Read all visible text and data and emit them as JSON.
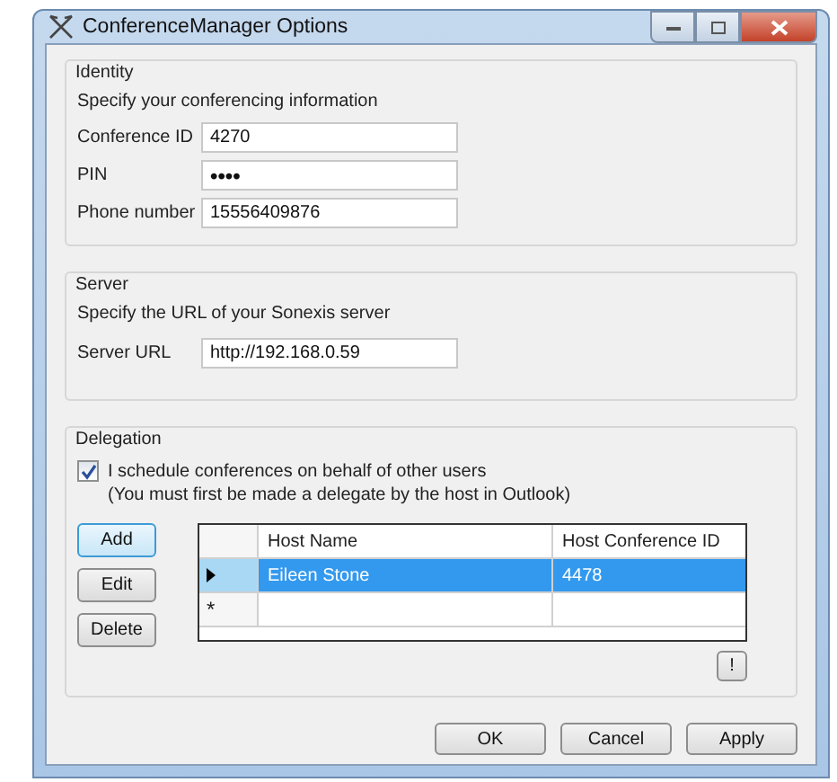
{
  "window": {
    "title": "ConferenceManager Options"
  },
  "identity": {
    "title": "Identity",
    "description": "Specify your conferencing information",
    "fields": [
      {
        "label": "Conference ID",
        "value": "4270"
      },
      {
        "label": "PIN",
        "value": "••••"
      },
      {
        "label": "Phone number",
        "value": "15556409876"
      }
    ]
  },
  "server": {
    "title": "Server",
    "description": "Specify the URL of your Sonexis server",
    "fields": [
      {
        "label": "Server URL",
        "value": "http://192.168.0.59"
      }
    ]
  },
  "delegation": {
    "title": "Delegation",
    "checkbox": {
      "label": "I schedule conferences on behalf of other users",
      "checked": true
    },
    "note": "(You must first be made a delegate by the host in Outlook)",
    "buttons": [
      "Add",
      "Edit",
      "Delete"
    ],
    "table": {
      "columns": [
        "Host Name",
        "Host Conference ID"
      ],
      "rows": [
        {
          "kind": "data",
          "selected": true,
          "cells": [
            "Eileen Stone",
            "4478"
          ]
        },
        {
          "kind": "new",
          "selected": false,
          "marker": "*",
          "cells": []
        }
      ]
    },
    "info_button": "!"
  },
  "buttons": [
    "OK",
    "Cancel",
    "Apply"
  ]
}
